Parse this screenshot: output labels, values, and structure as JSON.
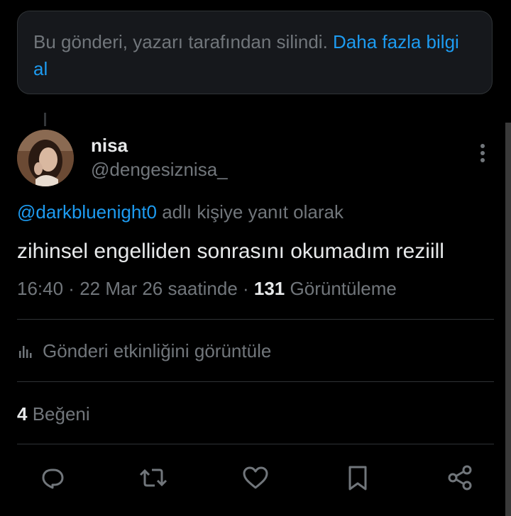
{
  "deleted_notice": {
    "text": "Bu gönderi, yazarı tarafından silindi. ",
    "link": "Daha fazla bilgi al"
  },
  "tweet": {
    "author_name": "nisa",
    "author_handle": "@dengesiznisa_",
    "reply_to_handle": "@darkbluenight0",
    "reply_to_suffix": " adlı kişiye yanıt olarak",
    "text": "zihinsel engelliden sonrasını okumadım reziill",
    "time": "16:40",
    "date": "22 Mar 26 saatinde",
    "views_count": "131",
    "views_label": "Görüntüleme",
    "activity_label": "Gönderi etkinliğini görüntüle",
    "likes_count": "4",
    "likes_label": "Beğeni"
  },
  "icons": {
    "more": "more-vertical-icon",
    "analytics": "bar-chart-icon",
    "reply": "comment-icon",
    "retweet": "retweet-icon",
    "like": "heart-icon",
    "bookmark": "bookmark-icon",
    "share": "share-icon"
  },
  "colors": {
    "background": "#000000",
    "link": "#1d9bf0",
    "muted": "#71767b",
    "text": "#e7e9ea",
    "border": "#2f3336"
  }
}
